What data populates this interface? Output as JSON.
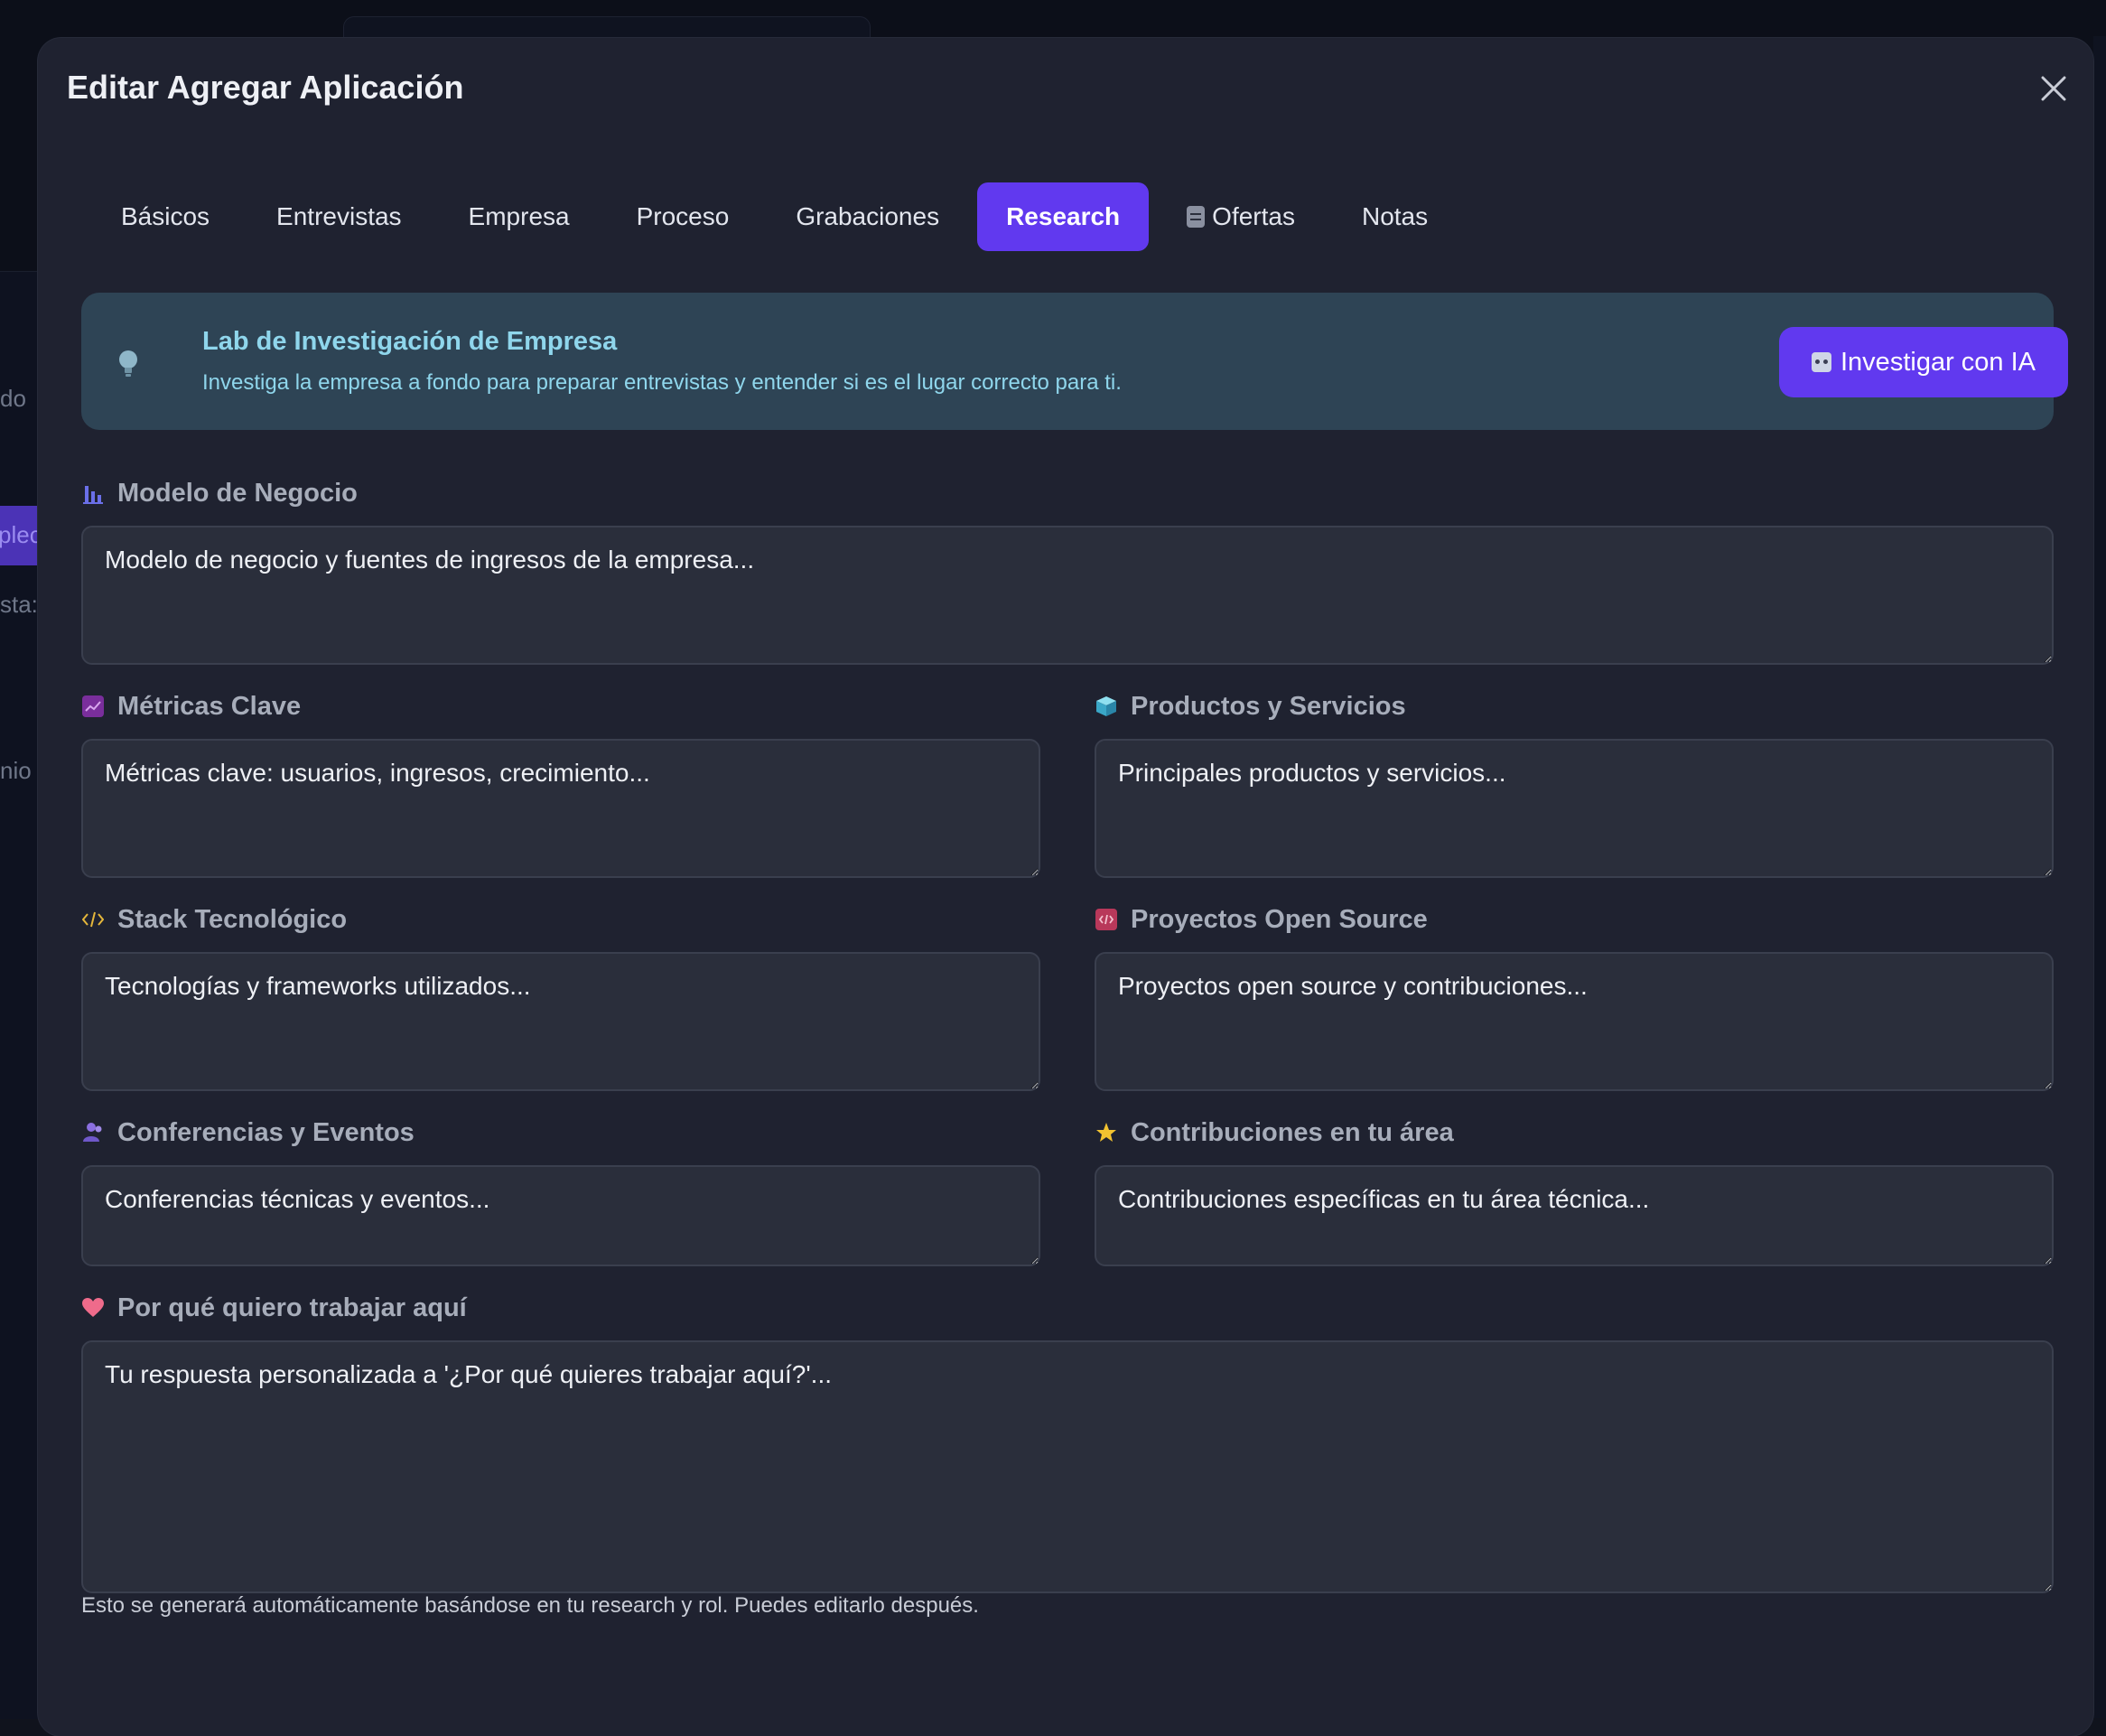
{
  "background": {
    "sidebar_fragments": [
      "do",
      "plec",
      "sta:",
      "nio"
    ]
  },
  "modal": {
    "title": "Editar Agregar Aplicación",
    "tabs": [
      {
        "label": "Básicos"
      },
      {
        "label": "Entrevistas"
      },
      {
        "label": "Empresa"
      },
      {
        "label": "Proceso"
      },
      {
        "label": "Grabaciones"
      },
      {
        "label": "Research",
        "active": true
      },
      {
        "label": "Ofertas",
        "icon": "document-icon"
      },
      {
        "label": "Notas"
      }
    ],
    "banner": {
      "icon": "lightbulb-icon",
      "title": "Lab de Investigación de Empresa",
      "description": "Investiga la empresa a fondo para preparar entrevistas y entender si es el lugar correcto para ti.",
      "button_label": "Investigar con IA",
      "button_icon": "robot-icon"
    },
    "fields": {
      "business_model": {
        "label": "Modelo de Negocio",
        "icon": "bar-chart-icon",
        "placeholder": "Modelo de negocio y fuentes de ingresos de la empresa..."
      },
      "key_metrics": {
        "label": "Métricas Clave",
        "icon": "trend-chart-icon",
        "placeholder": "Métricas clave: usuarios, ingresos, crecimiento..."
      },
      "products": {
        "label": "Productos y Servicios",
        "icon": "cube-icon",
        "placeholder": "Principales productos y servicios..."
      },
      "tech_stack": {
        "label": "Stack Tecnológico",
        "icon": "code-icon",
        "placeholder": "Tecnologías y frameworks utilizados..."
      },
      "open_source": {
        "label": "Proyectos Open Source",
        "icon": "code-badge-icon",
        "placeholder": "Proyectos open source y contribuciones..."
      },
      "conferences": {
        "label": "Conferencias y Eventos",
        "icon": "people-icon",
        "placeholder": "Conferencias técnicas y eventos..."
      },
      "contributions": {
        "label": "Contribuciones en tu área",
        "icon": "star-icon",
        "placeholder": "Contribuciones específicas en tu área técnica..."
      },
      "why_here": {
        "label": "Por qué quiero trabajar aquí",
        "icon": "heart-icon",
        "placeholder": "Tu respuesta personalizada a '¿Por qué quieres trabajar aquí?'..."
      }
    },
    "help_text": "Esto se generará automáticamente basándose en tu research y rol. Puedes editarlo después."
  },
  "colors": {
    "accent": "#6139ef",
    "modal_bg": "#1f2230",
    "banner_bg": "#2e4455",
    "banner_text": "#8fd6ec"
  }
}
